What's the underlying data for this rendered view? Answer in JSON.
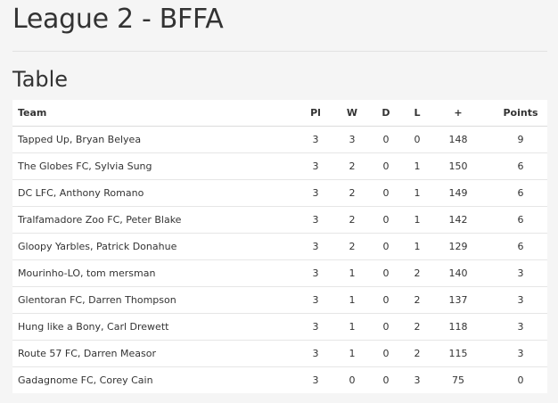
{
  "page": {
    "title": "League 2 - BFFA",
    "section_title": "Table"
  },
  "table": {
    "headers": {
      "team": "Team",
      "played": "Pl",
      "won": "W",
      "drawn": "D",
      "lost": "L",
      "points_for": "+",
      "points": "Points"
    },
    "rows": [
      {
        "team": "Tapped Up, Bryan Belyea",
        "played": "3",
        "won": "3",
        "drawn": "0",
        "lost": "0",
        "points_for": "148",
        "points": "9"
      },
      {
        "team": "The Globes FC, Sylvia Sung",
        "played": "3",
        "won": "2",
        "drawn": "0",
        "lost": "1",
        "points_for": "150",
        "points": "6"
      },
      {
        "team": "DC LFC, Anthony Romano",
        "played": "3",
        "won": "2",
        "drawn": "0",
        "lost": "1",
        "points_for": "149",
        "points": "6"
      },
      {
        "team": "Tralfamadore Zoo FC, Peter Blake",
        "played": "3",
        "won": "2",
        "drawn": "0",
        "lost": "1",
        "points_for": "142",
        "points": "6"
      },
      {
        "team": "Gloopy Yarbles, Patrick Donahue",
        "played": "3",
        "won": "2",
        "drawn": "0",
        "lost": "1",
        "points_for": "129",
        "points": "6"
      },
      {
        "team": "Mourinho-LO, tom mersman",
        "played": "3",
        "won": "1",
        "drawn": "0",
        "lost": "2",
        "points_for": "140",
        "points": "3"
      },
      {
        "team": "Glentoran FC, Darren Thompson",
        "played": "3",
        "won": "1",
        "drawn": "0",
        "lost": "2",
        "points_for": "137",
        "points": "3"
      },
      {
        "team": "Hung like a Bony, Carl Drewett",
        "played": "3",
        "won": "1",
        "drawn": "0",
        "lost": "2",
        "points_for": "118",
        "points": "3"
      },
      {
        "team": "Route 57 FC, Darren Measor",
        "played": "3",
        "won": "1",
        "drawn": "0",
        "lost": "2",
        "points_for": "115",
        "points": "3"
      },
      {
        "team": "Gadagnome FC, Corey Cain",
        "played": "3",
        "won": "0",
        "drawn": "0",
        "lost": "3",
        "points_for": "75",
        "points": "0"
      }
    ]
  },
  "colors": {
    "page_background": "#f5f5f5",
    "table_background": "#ffffff",
    "text": "#333333",
    "row_divider": "#e6e6e6"
  }
}
